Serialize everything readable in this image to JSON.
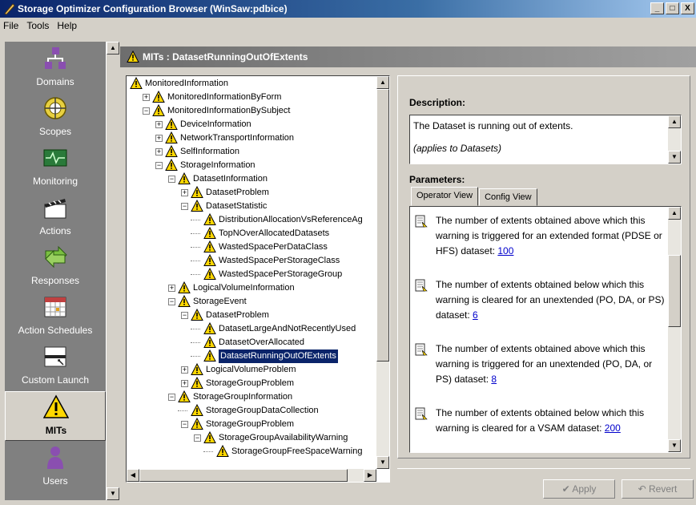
{
  "window": {
    "title": "Storage Optimizer Configuration Browser (WinSaw:pdbice)",
    "controls": {
      "minimize": "_",
      "maximize": "□",
      "close": "X"
    }
  },
  "menu": [
    "File",
    "Tools",
    "Help"
  ],
  "nav": {
    "items": [
      {
        "label": "Domains",
        "icon": "domains-icon"
      },
      {
        "label": "Scopes",
        "icon": "scopes-icon"
      },
      {
        "label": "Monitoring",
        "icon": "monitoring-icon"
      },
      {
        "label": "Actions",
        "icon": "actions-icon"
      },
      {
        "label": "Responses",
        "icon": "responses-icon"
      },
      {
        "label": "Action Schedules",
        "icon": "action-schedules-icon"
      },
      {
        "label": "Custom Launch",
        "icon": "custom-launch-icon"
      },
      {
        "label": "MITs",
        "icon": "warning-icon",
        "selected": true
      },
      {
        "label": "Users",
        "icon": "users-icon"
      }
    ]
  },
  "header": {
    "title": "MITs : DatasetRunningOutOfExtents"
  },
  "tree": {
    "nodes": [
      {
        "label": "MonitoredInformation",
        "level": 0,
        "exp": ""
      },
      {
        "label": "MonitoredInformationByForm",
        "level": 1,
        "exp": "+"
      },
      {
        "label": "MonitoredInformationBySubject",
        "level": 1,
        "exp": "-"
      },
      {
        "label": "DeviceInformation",
        "level": 2,
        "exp": "+"
      },
      {
        "label": "NetworkTransportInformation",
        "level": 2,
        "exp": "+"
      },
      {
        "label": "SelfInformation",
        "level": 2,
        "exp": "+"
      },
      {
        "label": "StorageInformation",
        "level": 2,
        "exp": "-"
      },
      {
        "label": "DatasetInformation",
        "level": 3,
        "exp": "-"
      },
      {
        "label": "DatasetProblem",
        "level": 4,
        "exp": "+"
      },
      {
        "label": "DatasetStatistic",
        "level": 4,
        "exp": "-"
      },
      {
        "label": "DistributionAllocationVsReferenceAg",
        "level": 5,
        "exp": ""
      },
      {
        "label": "TopNOverAllocatedDatasets",
        "level": 5,
        "exp": ""
      },
      {
        "label": "WastedSpacePerDataClass",
        "level": 5,
        "exp": ""
      },
      {
        "label": "WastedSpacePerStorageClass",
        "level": 5,
        "exp": ""
      },
      {
        "label": "WastedSpacePerStorageGroup",
        "level": 5,
        "exp": ""
      },
      {
        "label": "LogicalVolumeInformation",
        "level": 3,
        "exp": "+"
      },
      {
        "label": "StorageEvent",
        "level": 3,
        "exp": "-"
      },
      {
        "label": "DatasetProblem",
        "level": 4,
        "exp": "-"
      },
      {
        "label": "DatasetLargeAndNotRecentlyUsed",
        "level": 5,
        "exp": ""
      },
      {
        "label": "DatasetOverAllocated",
        "level": 5,
        "exp": ""
      },
      {
        "label": "DatasetRunningOutOfExtents",
        "level": 5,
        "exp": "",
        "selected": true
      },
      {
        "label": "LogicalVolumeProblem",
        "level": 4,
        "exp": "+"
      },
      {
        "label": "StorageGroupProblem",
        "level": 4,
        "exp": "+"
      },
      {
        "label": "StorageGroupInformation",
        "level": 3,
        "exp": "-"
      },
      {
        "label": "StorageGroupDataCollection",
        "level": 4,
        "exp": ""
      },
      {
        "label": "StorageGroupProblem",
        "level": 4,
        "exp": "-"
      },
      {
        "label": "StorageGroupAvailabilityWarning",
        "level": 5,
        "exp": "-"
      },
      {
        "label": "StorageGroupFreeSpaceWarning",
        "level": 6,
        "exp": ""
      }
    ]
  },
  "description": {
    "title": "Description:",
    "text": "The Dataset is running out of extents.",
    "applies": "(applies to Datasets)"
  },
  "parameters": {
    "title": "Parameters:",
    "tabs": [
      "Operator View",
      "Config View"
    ],
    "active_tab": "Operator View",
    "items": [
      {
        "text": "The number of extents obtained above which this warning is triggered for an extended format (PDSE or HFS) dataset:",
        "value": "100"
      },
      {
        "text": "The number of extents obtained below which this warning is cleared for an unextended (PO, DA, or PS) dataset:",
        "value": "6"
      },
      {
        "text": "The number of extents obtained above which this warning is triggered for an unextended (PO, DA, or PS) dataset:",
        "value": "8"
      },
      {
        "text": "The number of extents obtained below which this warning is cleared for a VSAM dataset:",
        "value": "200"
      }
    ]
  },
  "buttons": {
    "apply": "✔ Apply",
    "revert": "↶ Revert"
  },
  "colors": {
    "title_start": "#0a246a",
    "selection": "#0a246a",
    "nav_bg": "#808080",
    "warning_yellow": "#ffd700",
    "link": "#0000cc"
  }
}
